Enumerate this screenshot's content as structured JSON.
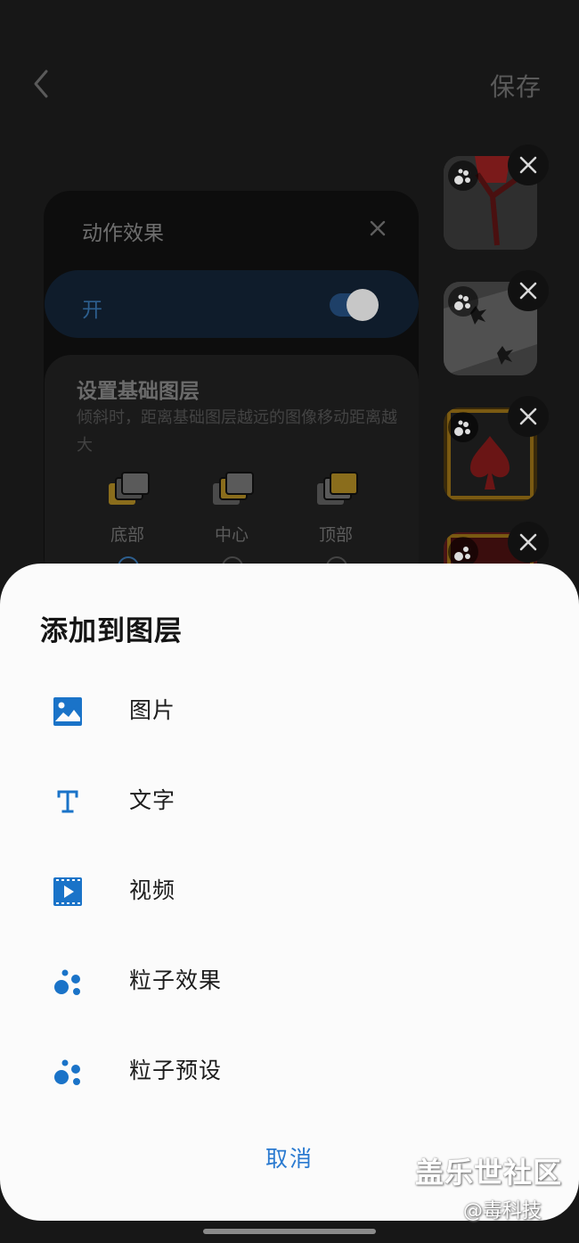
{
  "header": {
    "save_label": "保存"
  },
  "panel": {
    "title": "动作效果",
    "toggle_label": "开",
    "toggle_on": true
  },
  "base_layer": {
    "title": "设置基础图层",
    "description": "倾斜时，距离基础图层越远的图像移动距离越大",
    "options": [
      {
        "label": "底部"
      },
      {
        "label": "中心"
      },
      {
        "label": "顶部"
      }
    ]
  },
  "sheet": {
    "title": "添加到图层",
    "items": [
      {
        "label": "图片",
        "icon": "image-icon"
      },
      {
        "label": "文字",
        "icon": "text-icon"
      },
      {
        "label": "视频",
        "icon": "video-icon"
      },
      {
        "label": "粒子效果",
        "icon": "particle-icon"
      },
      {
        "label": "粒子预设",
        "icon": "particle-preset-icon"
      }
    ],
    "cancel_label": "取消"
  },
  "watermark": {
    "line1": "盖乐世社区",
    "line2": "@毒科技"
  },
  "colors": {
    "accent": "#1a73c8",
    "sheet_bg": "#fbfbfb",
    "dim_bg": "#171717"
  }
}
